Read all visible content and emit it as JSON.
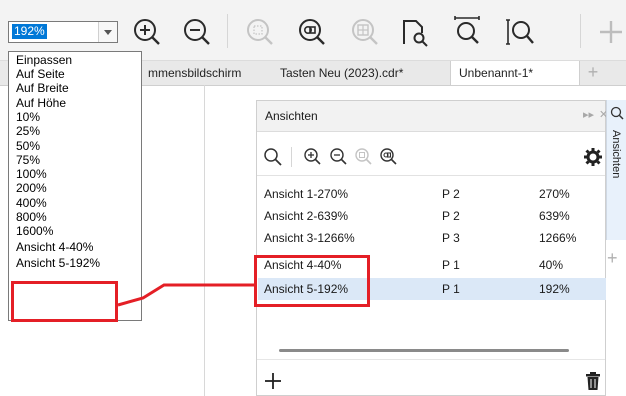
{
  "toolbar": {
    "zoom_value": "192%",
    "icons": [
      "zoom-in-icon",
      "zoom-out-icon",
      "zoom-selected-icon",
      "zoom-all-objects-icon",
      "zoom-fit-icon",
      "zoom-page-icon",
      "zoom-width-icon",
      "zoom-height-icon",
      "add-icon"
    ]
  },
  "tabs": [
    {
      "label": "mmensbildschirm"
    },
    {
      "label": "Tasten Neu (2023).cdr*"
    },
    {
      "label": "Unbenannt-1*"
    }
  ],
  "dropdown": {
    "items": [
      "Einpassen",
      "Auf Seite",
      "Auf Breite",
      "Auf Höhe",
      "10%",
      "25%",
      "50%",
      "75%",
      "100%",
      "200%",
      "400%",
      "800%",
      "1600%",
      "Ansicht 4-40%",
      "Ansicht 5-192%"
    ]
  },
  "panel": {
    "title": "Ansichten",
    "side_tab": "Ansichten",
    "rows": [
      {
        "name": "Ansicht 1-270%",
        "page": "P 2",
        "zoom": "270%"
      },
      {
        "name": "Ansicht 2-639%",
        "page": "P 2",
        "zoom": "639%"
      },
      {
        "name": "Ansicht 3-1266%",
        "page": "P 3",
        "zoom": "1266%"
      },
      {
        "name": "Ansicht 4-40%",
        "page": "P 1",
        "zoom": "40%"
      },
      {
        "name": "Ansicht 5-192%",
        "page": "P 1",
        "zoom": "192%"
      }
    ],
    "selected_row": 5
  },
  "colors": {
    "accent": "#0078d7",
    "callout": "#e41f26",
    "selection": "#dbe8f7"
  }
}
